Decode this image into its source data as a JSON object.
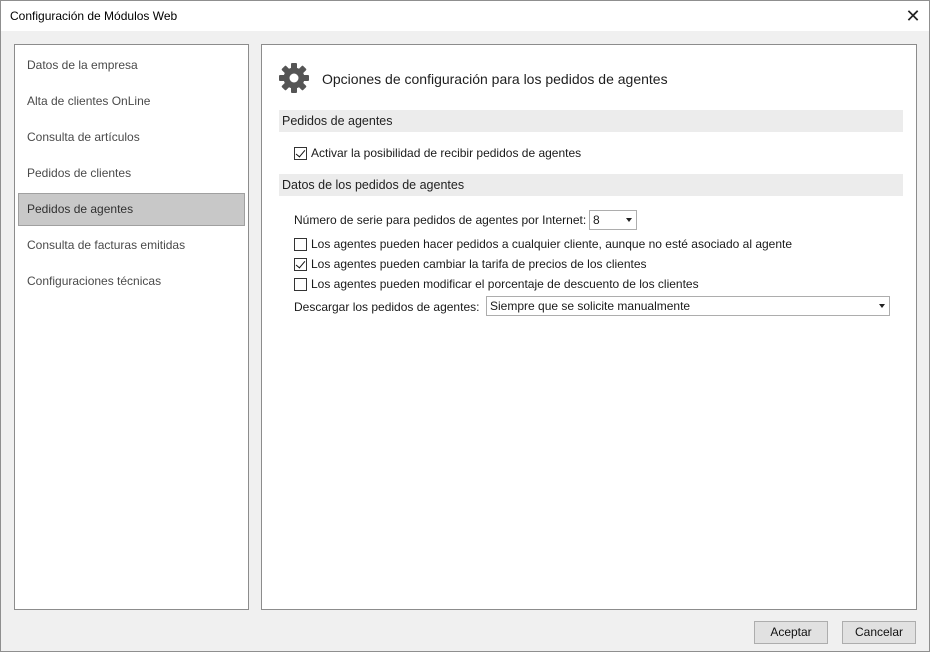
{
  "window": {
    "title": "Configuración de Módulos Web",
    "close_glyph": "✕"
  },
  "sidebar": {
    "items": [
      {
        "label": "Datos de la empresa"
      },
      {
        "label": "Alta de clientes OnLine"
      },
      {
        "label": "Consulta de artículos"
      },
      {
        "label": "Pedidos de clientes"
      },
      {
        "label": "Pedidos de agentes"
      },
      {
        "label": "Consulta de facturas emitidas"
      },
      {
        "label": "Configuraciones técnicas"
      }
    ],
    "selected": "Pedidos de agentes"
  },
  "content": {
    "icon": "gear-icon",
    "heading": "Opciones de configuración para los pedidos de agentes",
    "section1": {
      "title": "Pedidos de agentes",
      "activate": {
        "label": "Activar la posibilidad de recibir pedidos de agentes",
        "checked": true
      }
    },
    "section2": {
      "title": "Datos de los pedidos de agentes",
      "serie": {
        "label": "Número de serie para pedidos de agentes por Internet:",
        "value": "8"
      },
      "any_client": {
        "label": "Los agentes pueden hacer pedidos a cualquier cliente, aunque no esté asociado al agente",
        "checked": false
      },
      "change_rate": {
        "label": "Los agentes pueden cambiar la tarifa de precios de los clientes",
        "checked": true
      },
      "modify_discount": {
        "label": "Los agentes pueden modificar el porcentaje de descuento de los clientes",
        "checked": false
      },
      "download": {
        "label": "Descargar los pedidos de agentes:",
        "value": "Siempre que se solicite manualmente"
      }
    }
  },
  "footer": {
    "accept_label": "Aceptar",
    "cancel_label": "Cancelar"
  },
  "colors": {
    "window_bg": "#f0f0f0",
    "selected_item_bg": "#c8c8c8",
    "section_bg": "#ececec"
  }
}
